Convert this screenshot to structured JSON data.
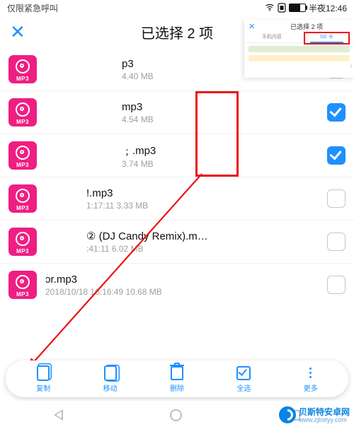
{
  "status": {
    "left": "仅限紧急呼叫",
    "time": "半夜12:46"
  },
  "header": {
    "title": "已选择 2 项"
  },
  "files": [
    {
      "id": 0,
      "name": "p3",
      "meta": "4.40 MB",
      "checked": false,
      "pad": 120
    },
    {
      "id": 1,
      "name": "mp3",
      "meta": "4.54 MB",
      "checked": true,
      "pad": 120
    },
    {
      "id": 2,
      "name": "﹔.mp3",
      "meta": "3.74 MB",
      "meta_pre": " ",
      "checked": true,
      "pad": 120
    },
    {
      "id": 3,
      "name": "!.mp3",
      "meta": "1:17:11 3.33 MB",
      "checked": false,
      "pad": 70
    },
    {
      "id": 4,
      "name": "② (DJ Candy Remix).m…",
      "meta": ":41:11 6.02 MB",
      "checked": false,
      "pad": 70
    },
    {
      "id": 5,
      "name": "ɔr.mp3",
      "meta": "2018/10/18 16:16:49 10.68 MB",
      "checked": false,
      "pad": 12
    }
  ],
  "mp3_label": "MP3",
  "actions": {
    "copy": "复制",
    "move": "移动",
    "delete": "删除",
    "select_all": "全选",
    "more": "更多"
  },
  "inset": {
    "title": "已选择 2 项",
    "tab_left": "手机内容",
    "tab_right": "SD 卡"
  },
  "watermark": {
    "line1": "贝斯特安卓网",
    "line2": "www.zjbstyy.com"
  }
}
